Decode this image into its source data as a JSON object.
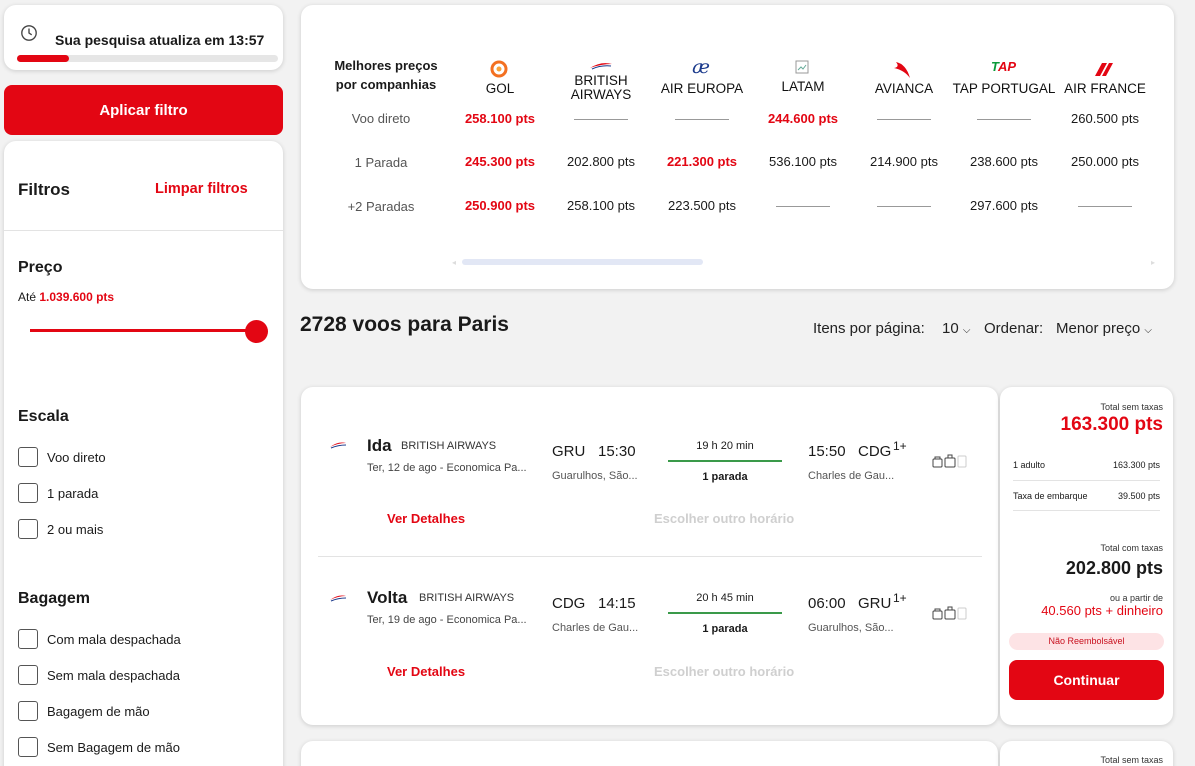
{
  "timer": {
    "text": "Sua pesquisa atualiza em 13:57",
    "progress": 0.2
  },
  "apply_button": "Aplicar filtro",
  "filters": {
    "title": "Filtros",
    "clear": "Limpar filtros",
    "price": {
      "title": "Preço",
      "prefix": "Até",
      "value": "1.039.600 pts"
    },
    "stops": {
      "title": "Escala",
      "options": [
        "Voo direto",
        "1 parada",
        "2 ou mais"
      ]
    },
    "baggage": {
      "title": "Bagagem",
      "options": [
        "Com mala despachada",
        "Sem mala despachada",
        "Bagagem de mão",
        "Sem Bagagem de mão"
      ]
    }
  },
  "comparison": {
    "header": "Melhores preços por companhias",
    "airlines": [
      "GOL",
      "BRITISH AIRWAYS",
      "AIR EUROPA",
      "LATAM",
      "AVIANCA",
      "TAP PORTUGAL",
      "AIR FRANCE"
    ],
    "rows": [
      {
        "label": "Voo direto",
        "values": [
          "258.100 pts",
          "",
          "",
          "244.600 pts",
          "",
          "",
          "260.500 pts"
        ],
        "highlight": [
          true,
          false,
          false,
          true,
          false,
          false,
          false
        ]
      },
      {
        "label": "1 Parada",
        "values": [
          "245.300 pts",
          "202.800 pts",
          "221.300 pts",
          "536.100 pts",
          "214.900 pts",
          "238.600 pts",
          "250.000 pts"
        ],
        "highlight": [
          true,
          false,
          true,
          false,
          false,
          false,
          false
        ]
      },
      {
        "label": "+2 Paradas",
        "values": [
          "250.900 pts",
          "258.100 pts",
          "223.500 pts",
          "",
          "",
          "297.600 pts",
          ""
        ],
        "highlight": [
          true,
          false,
          false,
          false,
          false,
          false,
          false
        ]
      }
    ]
  },
  "results": {
    "count_title": "2728 voos para Paris",
    "per_page_label": "Itens por página:",
    "per_page_value": "10",
    "sort_label": "Ordenar:",
    "sort_value": "Menor preço"
  },
  "flight": {
    "outbound": {
      "label": "Ida",
      "airline": "BRITISH AIRWAYS",
      "date": "Ter, 12 de ago - Economica Pa...",
      "from_code": "GRU",
      "dep_time": "15:30",
      "from_city": "Guarulhos, São...",
      "duration": "19 h 20 min",
      "stops": "1 parada",
      "arr_time": "15:50",
      "to_code": "CDG",
      "day_offset": "1+",
      "to_city": "Charles de Gau...",
      "details": "Ver Detalhes",
      "other_time": "Escolher outro horário"
    },
    "return": {
      "label": "Volta",
      "airline": "BRITISH AIRWAYS",
      "date": "Ter, 19 de ago - Economica Pa...",
      "from_code": "CDG",
      "dep_time": "14:15",
      "from_city": "Charles de Gau...",
      "duration": "20 h 45 min",
      "stops": "1 parada",
      "arr_time": "06:00",
      "to_code": "GRU",
      "day_offset": "1+",
      "to_city": "Guarulhos, São...",
      "details": "Ver Detalhes",
      "other_time": "Escolher outro horário"
    }
  },
  "price_box": {
    "total_no_tax_label": "Total sem taxas",
    "total_no_tax": "163.300 pts",
    "adult_label": "1 adulto",
    "adult_value": "163.300 pts",
    "tax_label": "Taxa de embarque",
    "tax_value": "39.500 pts",
    "total_tax_label": "Total com taxas",
    "total_tax": "202.800 pts",
    "from_label": "ou a partir de",
    "from_value": "40.560 pts + dinheiro",
    "badge": "Não Reembolsável",
    "continue": "Continuar"
  },
  "next_card": {
    "total_no_tax_label": "Total sem taxas"
  }
}
